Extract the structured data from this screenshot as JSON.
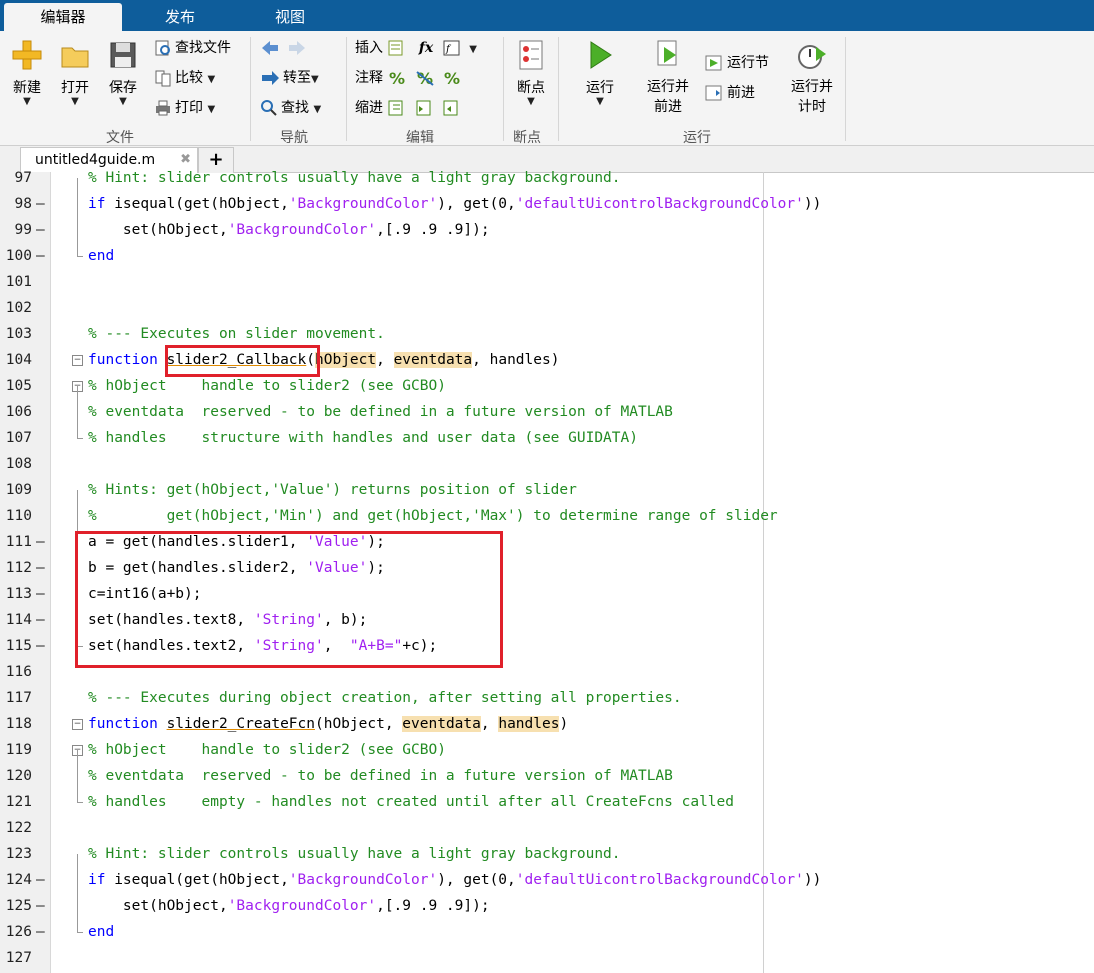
{
  "tabs": [
    "编辑器",
    "发布",
    "视图"
  ],
  "ribbon": {
    "file": {
      "new": "新建",
      "open": "打开",
      "save": "保存",
      "find_files": "查找文件",
      "compare": "比较",
      "print": "打印",
      "group": "文件"
    },
    "navigate": {
      "goto": "转至",
      "find": "查找",
      "group": "导航"
    },
    "edit": {
      "insert": "插入",
      "comment": "注释",
      "indent": "缩进",
      "fx": "fx",
      "group": "编辑"
    },
    "breakpoints": {
      "label": "断点",
      "group": "断点"
    },
    "run": {
      "run": "运行",
      "run_advance": "运行并\n前进",
      "run_section": "运行节",
      "advance": "前进",
      "run_time": "运行并\n计时",
      "group": "运行"
    }
  },
  "editor": {
    "file_tab": "untitled4guide.m",
    "add_tab": "+",
    "lines": [
      {
        "n": "97",
        "bp": false,
        "code": "% Hint: slider controls usually have a light gray background."
      },
      {
        "n": "98",
        "bp": true,
        "code": "if isequal(get(hObject,'BackgroundColor'), get(0,'defaultUicontrolBackgroundColor'))"
      },
      {
        "n": "99",
        "bp": true,
        "code": "    set(hObject,'BackgroundColor',[.9 .9 .9]);"
      },
      {
        "n": "100",
        "bp": true,
        "code": "end"
      },
      {
        "n": "101",
        "bp": false,
        "code": ""
      },
      {
        "n": "102",
        "bp": false,
        "code": ""
      },
      {
        "n": "103",
        "bp": false,
        "code": "% --- Executes on slider movement."
      },
      {
        "n": "104",
        "bp": false,
        "code": "function slider2_Callback(hObject, eventdata, handles)"
      },
      {
        "n": "105",
        "bp": false,
        "code": "% hObject    handle to slider2 (see GCBO)"
      },
      {
        "n": "106",
        "bp": false,
        "code": "% eventdata  reserved - to be defined in a future version of MATLAB"
      },
      {
        "n": "107",
        "bp": false,
        "code": "% handles    structure with handles and user data (see GUIDATA)"
      },
      {
        "n": "108",
        "bp": false,
        "code": ""
      },
      {
        "n": "109",
        "bp": false,
        "code": "% Hints: get(hObject,'Value') returns position of slider"
      },
      {
        "n": "110",
        "bp": false,
        "code": "%        get(hObject,'Min') and get(hObject,'Max') to determine range of slider"
      },
      {
        "n": "111",
        "bp": true,
        "code": "a = get(handles.slider1, 'Value');"
      },
      {
        "n": "112",
        "bp": true,
        "code": "b = get(handles.slider2, 'Value');"
      },
      {
        "n": "113",
        "bp": true,
        "code": "c=int16(a+b);"
      },
      {
        "n": "114",
        "bp": true,
        "code": "set(handles.text8, 'String', b);"
      },
      {
        "n": "115",
        "bp": true,
        "code": "set(handles.text2, 'String',  \"A+B=\"+c);"
      },
      {
        "n": "116",
        "bp": false,
        "code": ""
      },
      {
        "n": "117",
        "bp": false,
        "code": "% --- Executes during object creation, after setting all properties."
      },
      {
        "n": "118",
        "bp": false,
        "code": "function slider2_CreateFcn(hObject, eventdata, handles)"
      },
      {
        "n": "119",
        "bp": false,
        "code": "% hObject    handle to slider2 (see GCBO)"
      },
      {
        "n": "120",
        "bp": false,
        "code": "% eventdata  reserved - to be defined in a future version of MATLAB"
      },
      {
        "n": "121",
        "bp": false,
        "code": "% handles    empty - handles not created until after all CreateFcns called"
      },
      {
        "n": "122",
        "bp": false,
        "code": ""
      },
      {
        "n": "123",
        "bp": false,
        "code": "% Hint: slider controls usually have a light gray background."
      },
      {
        "n": "124",
        "bp": true,
        "code": "if isequal(get(hObject,'BackgroundColor'), get(0,'defaultUicontrolBackgroundColor'))"
      },
      {
        "n": "125",
        "bp": true,
        "code": "    set(hObject,'BackgroundColor',[.9 .9 .9]);"
      },
      {
        "n": "126",
        "bp": true,
        "code": "end"
      },
      {
        "n": "127",
        "bp": false,
        "code": ""
      }
    ]
  },
  "colors": {
    "keyword": "#0000ff",
    "comment": "#228b22",
    "string": "#a020f0",
    "highlight": "#f7e0b0",
    "annotation": "#e0202a",
    "titlebar": "#0e5d9b"
  }
}
